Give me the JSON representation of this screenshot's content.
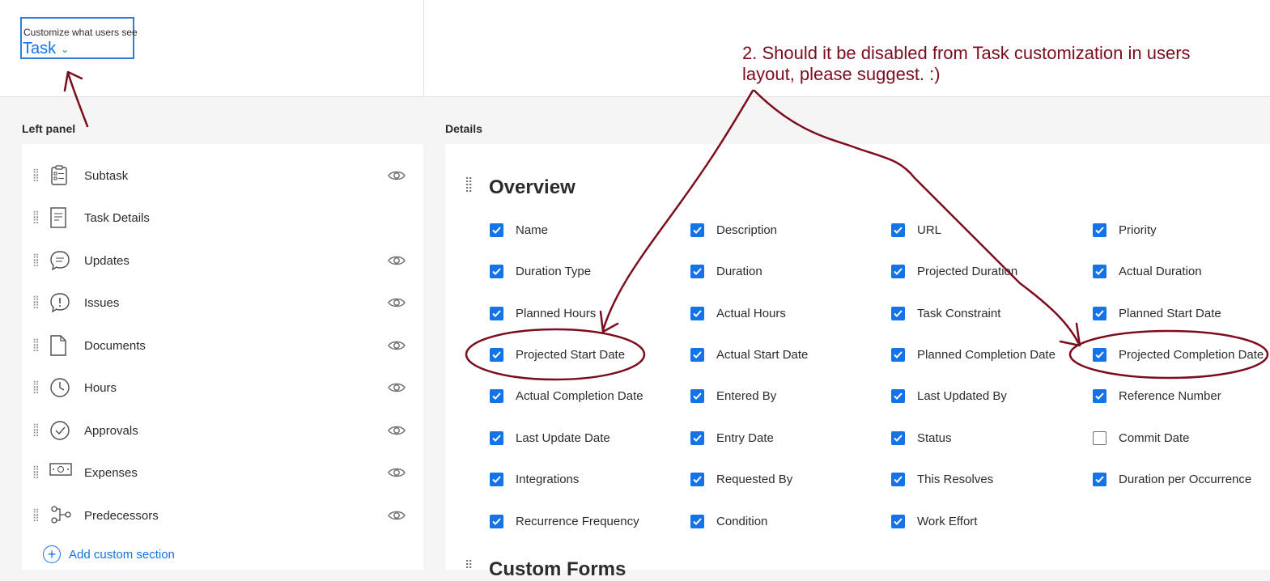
{
  "header": {
    "customize_label": "Customize what users see",
    "selected_object": "Task"
  },
  "left_panel": {
    "title": "Left panel",
    "items": [
      {
        "label": "Subtask",
        "icon": "subtask-icon",
        "visible_toggle": true
      },
      {
        "label": "Task Details",
        "icon": "document-lines-icon",
        "visible_toggle": false
      },
      {
        "label": "Updates",
        "icon": "chat-bubble-icon",
        "visible_toggle": true
      },
      {
        "label": "Issues",
        "icon": "issue-bubble-icon",
        "visible_toggle": true
      },
      {
        "label": "Documents",
        "icon": "file-icon",
        "visible_toggle": true
      },
      {
        "label": "Hours",
        "icon": "clock-icon",
        "visible_toggle": true
      },
      {
        "label": "Approvals",
        "icon": "check-circle-icon",
        "visible_toggle": true
      },
      {
        "label": "Expenses",
        "icon": "money-icon",
        "visible_toggle": true
      },
      {
        "label": "Predecessors",
        "icon": "predecessors-icon",
        "visible_toggle": true
      }
    ],
    "add_custom_section": "Add custom section"
  },
  "details": {
    "title": "Details",
    "overview_title": "Overview",
    "fields": [
      [
        {
          "label": "Name",
          "checked": true
        },
        {
          "label": "Description",
          "checked": true
        },
        {
          "label": "URL",
          "checked": true
        },
        {
          "label": "Priority",
          "checked": true
        }
      ],
      [
        {
          "label": "Duration Type",
          "checked": true
        },
        {
          "label": "Duration",
          "checked": true
        },
        {
          "label": "Projected Duration",
          "checked": true
        },
        {
          "label": "Actual Duration",
          "checked": true
        }
      ],
      [
        {
          "label": "Planned Hours",
          "checked": true
        },
        {
          "label": "Actual Hours",
          "checked": true
        },
        {
          "label": "Task Constraint",
          "checked": true
        },
        {
          "label": "Planned Start Date",
          "checked": true
        }
      ],
      [
        {
          "label": "Projected Start Date",
          "checked": true
        },
        {
          "label": "Actual Start Date",
          "checked": true
        },
        {
          "label": "Planned Completion Date",
          "checked": true
        },
        {
          "label": "Projected Completion Date",
          "checked": true
        }
      ],
      [
        {
          "label": "Actual Completion Date",
          "checked": true
        },
        {
          "label": "Entered By",
          "checked": true
        },
        {
          "label": "Last Updated By",
          "checked": true
        },
        {
          "label": "Reference Number",
          "checked": true
        }
      ],
      [
        {
          "label": "Last Update Date",
          "checked": true
        },
        {
          "label": "Entry Date",
          "checked": true
        },
        {
          "label": "Status",
          "checked": true
        },
        {
          "label": "Commit Date",
          "checked": false
        }
      ],
      [
        {
          "label": "Integrations",
          "checked": true
        },
        {
          "label": "Requested By",
          "checked": true
        },
        {
          "label": "This Resolves",
          "checked": true
        },
        {
          "label": "Duration per Occurrence",
          "checked": true
        }
      ],
      [
        {
          "label": "Recurrence Frequency",
          "checked": true
        },
        {
          "label": "Condition",
          "checked": true
        },
        {
          "label": "Work Effort",
          "checked": true
        }
      ]
    ],
    "next_section_title": "Custom Forms"
  },
  "annotation": {
    "text": "2. Should it be disabled from Task customization in users layout, please suggest. :)",
    "color": "#7b0d1e"
  },
  "colors": {
    "accent": "#1473e6",
    "annotation": "#7b0d1e"
  }
}
